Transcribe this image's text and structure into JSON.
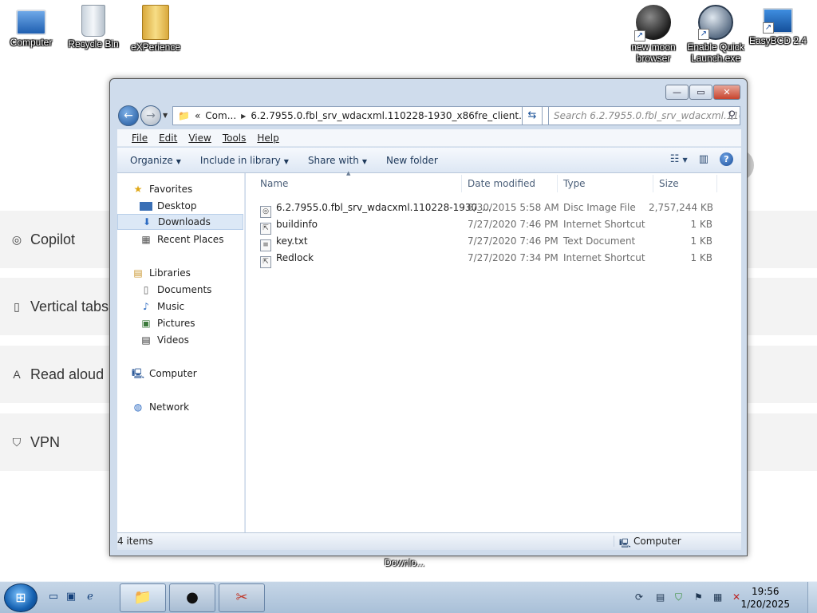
{
  "desktop_icons_left": [
    {
      "label": "Computer",
      "icon": "computer-icon",
      "glyph": "🖥"
    },
    {
      "label": "Recycle Bin",
      "icon": "recycle-bin-icon",
      "glyph": "🗑"
    },
    {
      "label": "eXPerience",
      "icon": "folder-icon",
      "glyph": "📁"
    }
  ],
  "desktop_icons_right": [
    {
      "label": "new moon browser",
      "icon": "moon-icon",
      "glyph": "●"
    },
    {
      "label": "Enable Quick Launch.exe",
      "icon": "quick-launch-icon",
      "glyph": "▲"
    },
    {
      "label": "EasyBCD 2.4",
      "icon": "easybcd-icon",
      "glyph": "🖥"
    }
  ],
  "background_page": {
    "items": [
      {
        "label": "Copilot",
        "icon": "copilot-icon",
        "glyph": "◎"
      },
      {
        "label": "Vertical tabs",
        "icon": "vertical-tabs-icon",
        "glyph": "▯"
      },
      {
        "label": "Read aloud",
        "icon": "read-aloud-icon",
        "glyph": "A"
      },
      {
        "label": "VPN",
        "icon": "vpn-icon",
        "glyph": "⛉"
      }
    ]
  },
  "explorer": {
    "caption": {
      "minimize": "—",
      "maximize": "▭",
      "close": "✕"
    },
    "address": {
      "prefix": "«",
      "crumb1": "Com...",
      "crumb2": "6.2.7955.0.fbl_srv_wdacxml.110228-1930_x86fre_client...",
      "dropdown": "▼"
    },
    "search_placeholder": "Search 6.2.7955.0.fbl_srv_wdacxml.110...",
    "menu": [
      "File",
      "Edit",
      "View",
      "Tools",
      "Help"
    ],
    "toolbar": {
      "organize": "Organize",
      "include": "Include in library",
      "share": "Share with",
      "new_folder": "New folder",
      "help": "?"
    },
    "nav": {
      "favorites": "Favorites",
      "desktop": "Desktop",
      "downloads": "Downloads",
      "recent": "Recent Places",
      "libraries": "Libraries",
      "documents": "Documents",
      "music": "Music",
      "pictures": "Pictures",
      "videos": "Videos",
      "computer": "Computer",
      "network": "Network"
    },
    "columns": {
      "name": "Name",
      "date": "Date modified",
      "type": "Type",
      "size": "Size"
    },
    "files": [
      {
        "name": "6.2.7955.0.fbl_srv_wdacxml.110228-1930_...",
        "date": "8/30/2015 5:58 AM",
        "type": "Disc Image File",
        "size": "2,757,244 KB",
        "glyph": "◎"
      },
      {
        "name": "buildinfo",
        "date": "7/27/2020 7:46 PM",
        "type": "Internet Shortcut",
        "size": "1 KB",
        "glyph": "⇱"
      },
      {
        "name": "key.txt",
        "date": "7/27/2020 7:46 PM",
        "type": "Text Document",
        "size": "1 KB",
        "glyph": "≡"
      },
      {
        "name": "Redlock",
        "date": "7/27/2020 7:34 PM",
        "type": "Internet Shortcut",
        "size": "1 KB",
        "glyph": "⇱"
      }
    ],
    "status": {
      "count": "4 items",
      "zone": "Computer"
    }
  },
  "tooltip": "Downlo...",
  "taskbar": {
    "clock_time": "19:56",
    "clock_date": "1/20/2025"
  }
}
